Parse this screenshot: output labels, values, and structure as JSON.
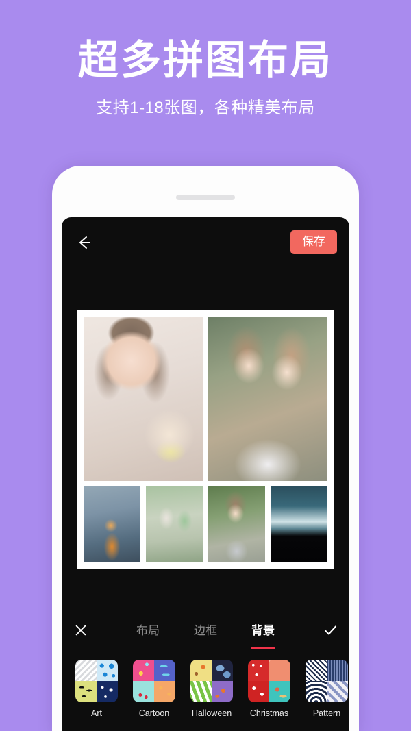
{
  "promo": {
    "title": "超多拼图布局",
    "subtitle": "支持1-18张图，各种精美布局",
    "background_color": "#a98bee",
    "text_color": "#ffffff"
  },
  "phone": {
    "frame_color": "#fdfdfd",
    "screen_color": "#0d0d0d",
    "speaker_name": "speaker-grille"
  },
  "appbar": {
    "back_icon": "arrow-left-icon",
    "save_label": "保存",
    "save_color": "#f2685f"
  },
  "collage": {
    "frame_color": "#ffffff",
    "photo_count": 6,
    "photos": [
      {
        "name": "photo-selfie-drink",
        "row": "top"
      },
      {
        "name": "photo-two-friends",
        "row": "top"
      },
      {
        "name": "photo-street-orange",
        "row": "bottom"
      },
      {
        "name": "photo-sunglasses-pair",
        "row": "bottom"
      },
      {
        "name": "photo-girl-greenery",
        "row": "bottom"
      },
      {
        "name": "photo-mountain-dusk",
        "row": "bottom"
      }
    ]
  },
  "toolbar": {
    "close_icon": "close-icon",
    "confirm_icon": "check-icon",
    "active_tab_index": 2,
    "active_underline_color": "#f0344a",
    "tabs": [
      {
        "label": "布局",
        "name": "tab-layout",
        "active": false
      },
      {
        "label": "边框",
        "name": "tab-border",
        "active": false
      },
      {
        "label": "背景",
        "name": "tab-background",
        "active": true
      }
    ]
  },
  "background_strip": {
    "items": [
      {
        "label": "Art",
        "name": "bg-item-art",
        "quadrants": [
          "art-a",
          "art-b",
          "art-c",
          "art-d"
        ]
      },
      {
        "label": "Cartoon",
        "name": "bg-item-cartoon",
        "quadrants": [
          "car-a",
          "car-b",
          "car-c",
          "car-d"
        ]
      },
      {
        "label": "Halloween",
        "name": "bg-item-halloween",
        "quadrants": [
          "hal-a",
          "hal-b",
          "hal-c",
          "hal-d"
        ]
      },
      {
        "label": "Christmas",
        "name": "bg-item-christmas",
        "quadrants": [
          "chr-a",
          "chr-b",
          "chr-c",
          "chr-d"
        ]
      },
      {
        "label": "Pattern",
        "name": "bg-item-pattern",
        "quadrants": [
          "pat-a",
          "pat-b",
          "pat-c",
          "pat-d"
        ]
      },
      {
        "label": "",
        "name": "bg-item-partial",
        "quadrants": [
          "pl-a",
          "pl-b",
          "pl-c",
          "pl-d"
        ]
      }
    ]
  }
}
